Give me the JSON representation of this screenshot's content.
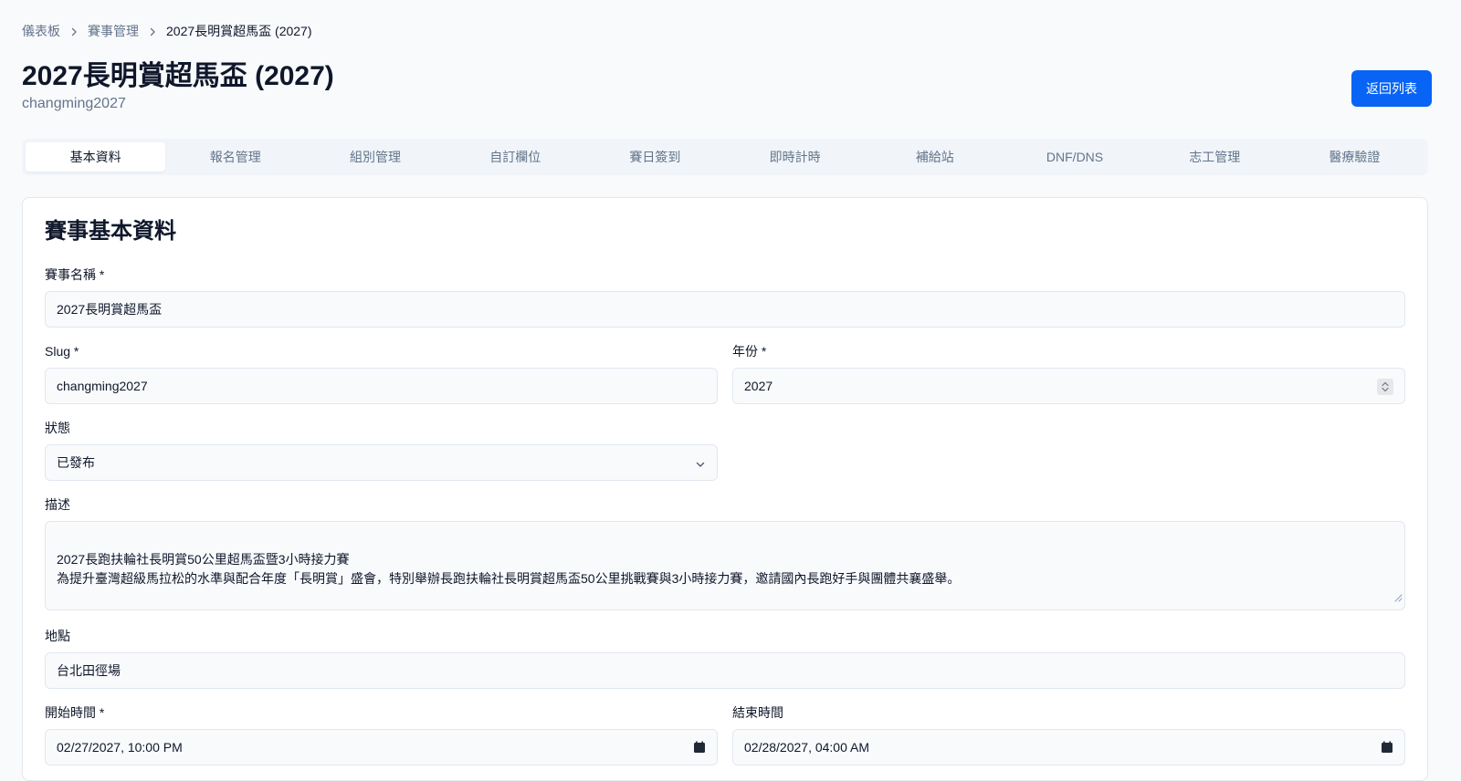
{
  "breadcrumb": {
    "items": [
      "儀表板",
      "賽事管理"
    ],
    "current": "2027長明賞超馬盃 (2027)"
  },
  "header": {
    "title": "2027長明賞超馬盃 (2027)",
    "subtitle": "changming2027",
    "back_button_label": "返回列表"
  },
  "tabs": [
    {
      "label": "基本資料",
      "active": true
    },
    {
      "label": "報名管理"
    },
    {
      "label": "組別管理"
    },
    {
      "label": "自訂欄位"
    },
    {
      "label": "賽日簽到"
    },
    {
      "label": "即時計時"
    },
    {
      "label": "補給站"
    },
    {
      "label": "DNF/DNS"
    },
    {
      "label": "志工管理"
    },
    {
      "label": "醫療驗證"
    }
  ],
  "form": {
    "title": "賽事基本資料",
    "name": {
      "label": "賽事名稱 *",
      "value": "2027長明賞超馬盃"
    },
    "slug": {
      "label": "Slug *",
      "value": "changming2027"
    },
    "year": {
      "label": "年份 *",
      "value": "2027"
    },
    "status": {
      "label": "狀態",
      "value": "已發布"
    },
    "description": {
      "label": "描述",
      "value": "2027長跑扶輪社長明賞50公里超馬盃暨3小時接力賽\n為提升臺灣超級馬拉松的水準與配合年度「長明賞」盛會，特別舉辦長跑扶輪社長明賞超馬盃50公里挑戰賽與3小時接力賽，邀請國內長跑好手與團體共襄盛舉。"
    },
    "location": {
      "label": "地點",
      "value": "台北田徑場"
    },
    "start_time": {
      "label": "開始時間 *",
      "value": "02/27/2027, 10:00 PM"
    },
    "end_time": {
      "label": "結束時間",
      "value": "02/28/2027, 04:00 AM"
    }
  }
}
